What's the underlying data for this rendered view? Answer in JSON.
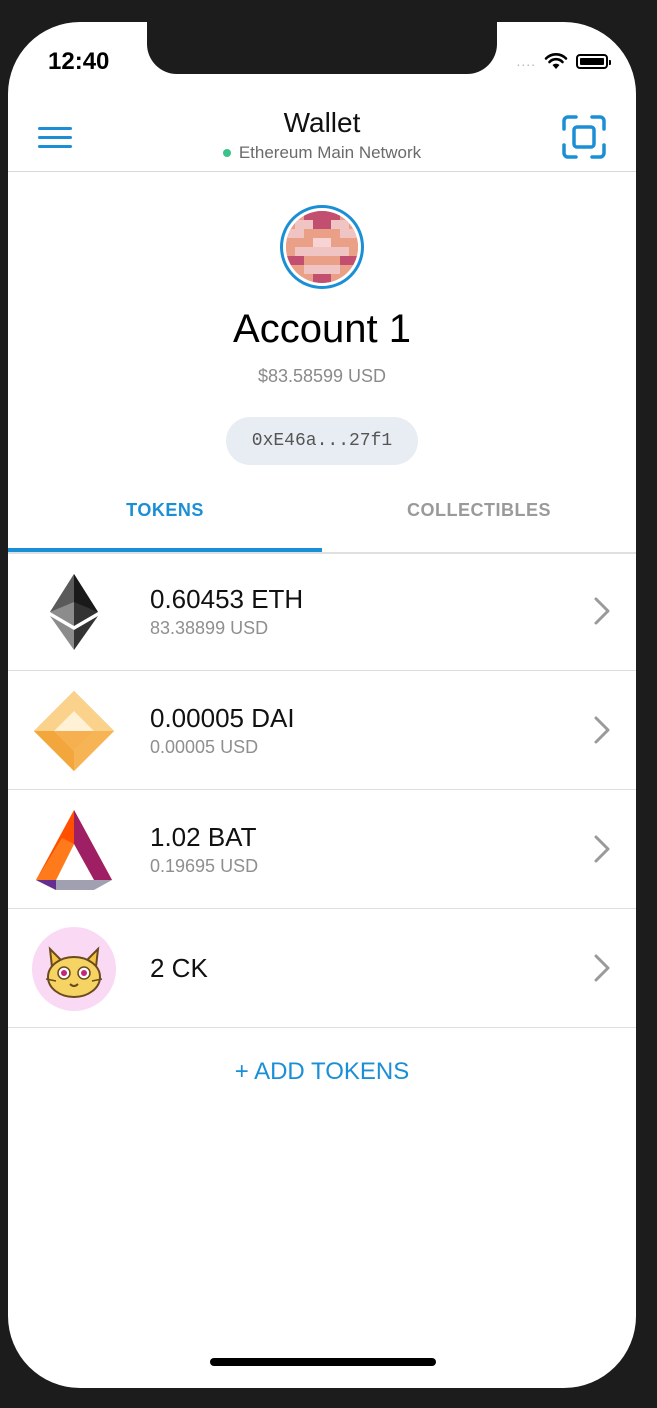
{
  "status_bar": {
    "time": "12:40",
    "signal": "....",
    "wifi_icon": "wifi-icon",
    "battery_icon": "battery-icon"
  },
  "header": {
    "menu_icon": "hamburger-menu-icon",
    "title": "Wallet",
    "network": "Ethereum Main Network",
    "network_status_color": "#3ac388",
    "scan_icon": "qr-scan-icon"
  },
  "account": {
    "name": "Account 1",
    "balance": "$83.58599 USD",
    "address": "0xE46a...27f1"
  },
  "tabs": [
    {
      "label": "TOKENS",
      "active": true
    },
    {
      "label": "COLLECTIBLES",
      "active": false
    }
  ],
  "tokens": [
    {
      "icon": "ethereum-icon",
      "amount": "0.60453 ETH",
      "fiat": "83.38899 USD"
    },
    {
      "icon": "dai-icon",
      "amount": "0.00005 DAI",
      "fiat": "0.00005 USD"
    },
    {
      "icon": "bat-icon",
      "amount": "1.02 BAT",
      "fiat": "0.19695 USD"
    },
    {
      "icon": "cryptokitties-icon",
      "amount": "2 CK",
      "fiat": ""
    }
  ],
  "add_tokens_label": "+ ADD TOKENS",
  "colors": {
    "accent": "#1b8fd6"
  }
}
